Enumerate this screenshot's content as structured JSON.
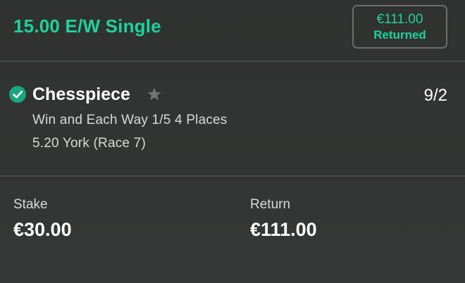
{
  "header": {
    "bet_title": "15.00 E/W Single",
    "returned_amount": "€111.00",
    "returned_label": "Returned"
  },
  "selection": {
    "name": "Chesspiece",
    "odds": "9/2",
    "market": "Win and Each Way 1/5 4 Places",
    "event": "5.20 York (Race 7)",
    "status_icon": "check-circle-icon",
    "favourite_icon": "star-icon"
  },
  "totals": {
    "stake_label": "Stake",
    "stake_value": "€30.00",
    "return_label": "Return",
    "return_value": "€111.00"
  },
  "colors": {
    "accent": "#1ed39a",
    "background": "#313432",
    "check": "#1ba57a"
  }
}
